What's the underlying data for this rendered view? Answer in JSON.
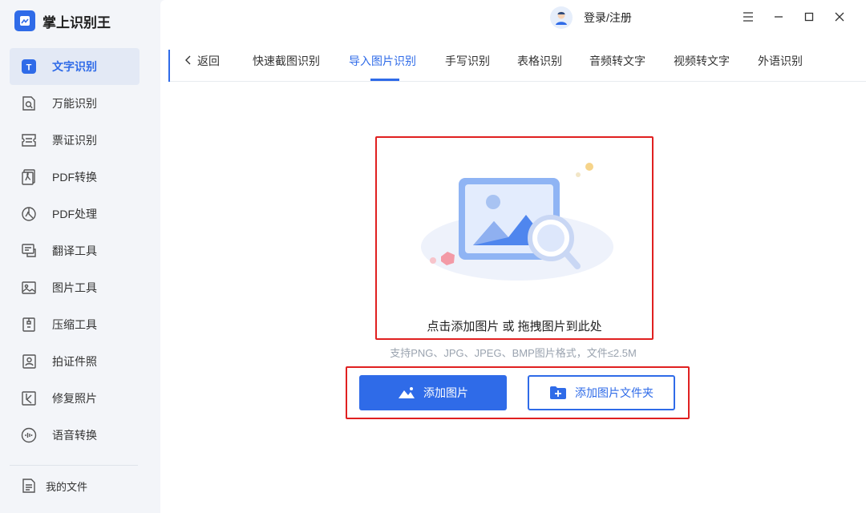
{
  "app": {
    "title": "掌上识别王"
  },
  "sidebar": {
    "items": [
      {
        "label": "文字识别",
        "icon": "text-recognition-icon",
        "active": true
      },
      {
        "label": "万能识别",
        "icon": "universal-scan-icon"
      },
      {
        "label": "票证识别",
        "icon": "ticket-icon"
      },
      {
        "label": "PDF转换",
        "icon": "pdf-convert-icon"
      },
      {
        "label": "PDF处理",
        "icon": "pdf-process-icon"
      },
      {
        "label": "翻译工具",
        "icon": "translate-icon"
      },
      {
        "label": "图片工具",
        "icon": "image-tools-icon"
      },
      {
        "label": "压缩工具",
        "icon": "compress-icon"
      },
      {
        "label": "拍证件照",
        "icon": "id-photo-icon"
      },
      {
        "label": "修复照片",
        "icon": "repair-photo-icon"
      },
      {
        "label": "语音转换",
        "icon": "voice-convert-icon"
      }
    ],
    "my_files": "我的文件"
  },
  "topbar": {
    "login": "登录/注册"
  },
  "tabs": {
    "back": "返回",
    "items": [
      "快速截图识别",
      "导入图片识别",
      "手写识别",
      "表格识别",
      "音频转文字",
      "视频转文字",
      "外语识别"
    ],
    "active_index": 1
  },
  "upload": {
    "drop_text": "点击添加图片 或 拖拽图片到此处",
    "hint": "支持PNG、JPG、JPEG、BMP图片格式，文件≤2.5M",
    "add_image": "添加图片",
    "add_folder": "添加图片文件夹"
  },
  "colors": {
    "accent": "#2f6be8",
    "highlight": "#e02020",
    "sidebar_bg": "#f3f5f9"
  }
}
